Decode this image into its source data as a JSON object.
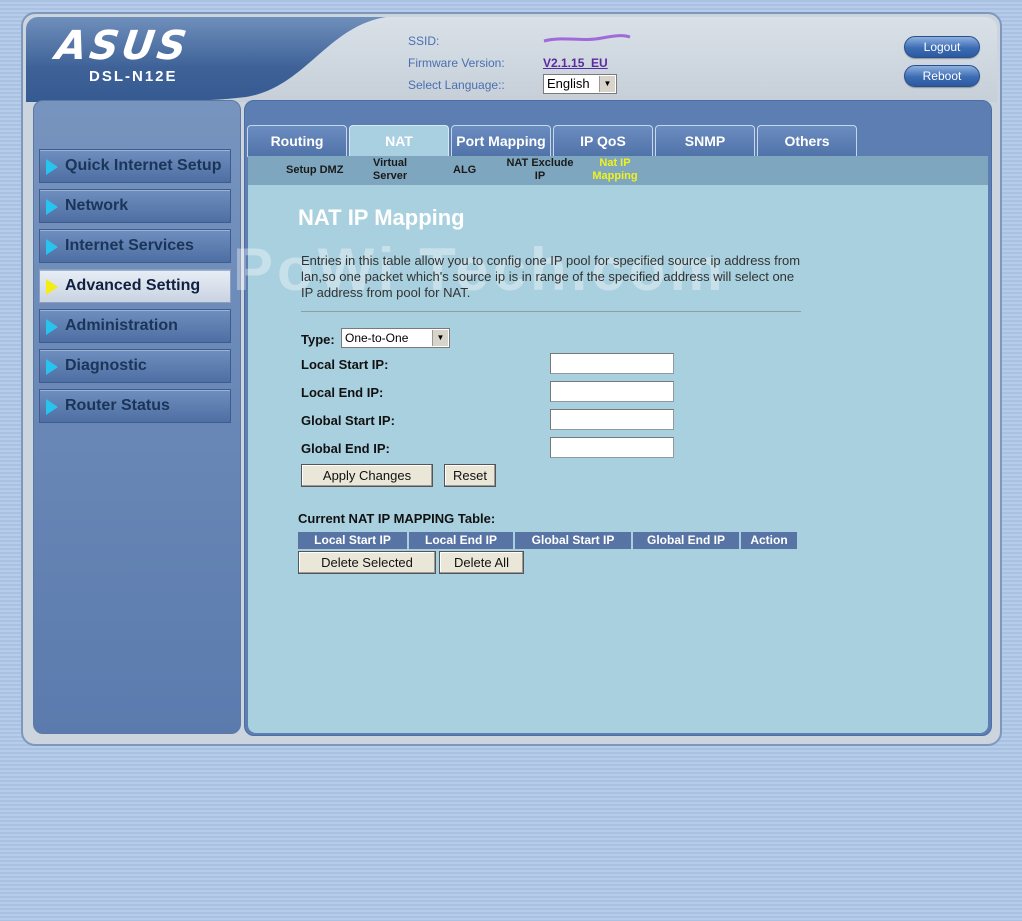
{
  "header": {
    "brand": "ASUS",
    "model": "DSL-N12E",
    "ssid_label": "SSID:",
    "firmware_label": "Firmware Version:",
    "firmware_value": "V2.1.15_EU",
    "language_label": "Select Language::",
    "language_value": "English",
    "logout_label": "Logout",
    "reboot_label": "Reboot"
  },
  "sidebar": {
    "items": [
      {
        "label": "Quick Internet Setup",
        "active": false
      },
      {
        "label": "Network",
        "active": false
      },
      {
        "label": "Internet Services",
        "active": false
      },
      {
        "label": "Advanced Setting",
        "active": true
      },
      {
        "label": "Administration",
        "active": false
      },
      {
        "label": "Diagnostic",
        "active": false
      },
      {
        "label": "Router Status",
        "active": false
      }
    ]
  },
  "tabs": [
    {
      "label": "Routing",
      "active": false
    },
    {
      "label": "NAT",
      "active": true
    },
    {
      "label": "Port Mapping",
      "active": false
    },
    {
      "label": "IP QoS",
      "active": false
    },
    {
      "label": "SNMP",
      "active": false
    },
    {
      "label": "Others",
      "active": false
    }
  ],
  "subtabs": [
    {
      "label": "Setup DMZ",
      "active": false
    },
    {
      "label": "Virtual Server",
      "active": false
    },
    {
      "label": "ALG",
      "active": false
    },
    {
      "label": "NAT Exclude IP",
      "active": false
    },
    {
      "label": "Nat IP Mapping",
      "active": true
    }
  ],
  "main": {
    "title": "NAT IP Mapping",
    "watermark": "PoWi   Tech.com",
    "description": "Entries in this table allow you to config one IP pool for specified source ip address from lan,so one packet which's source ip is in range of the specified address will select one IP address from pool for NAT.",
    "type_label": "Type:",
    "type_value": "One-to-One",
    "fields": {
      "local_start": "Local Start IP:",
      "local_end": "Local End IP:",
      "global_start": "Global Start IP:",
      "global_end": "Global End IP:"
    },
    "values": {
      "local_start": "",
      "local_end": "",
      "global_start": "",
      "global_end": ""
    },
    "apply_label": "Apply Changes",
    "reset_label": "Reset",
    "table_title": "Current NAT IP MAPPING Table:",
    "table_columns": [
      "Local Start IP",
      "Local End IP",
      "Global Start IP",
      "Global End IP",
      "Action"
    ],
    "delete_selected_label": "Delete Selected",
    "delete_all_label": "Delete All"
  },
  "colors": {
    "accent": "#5c7eb2",
    "content_bg": "#a9d0df",
    "active_subtab": "#f2f21a",
    "nav_arrow": "#28c4f0"
  }
}
